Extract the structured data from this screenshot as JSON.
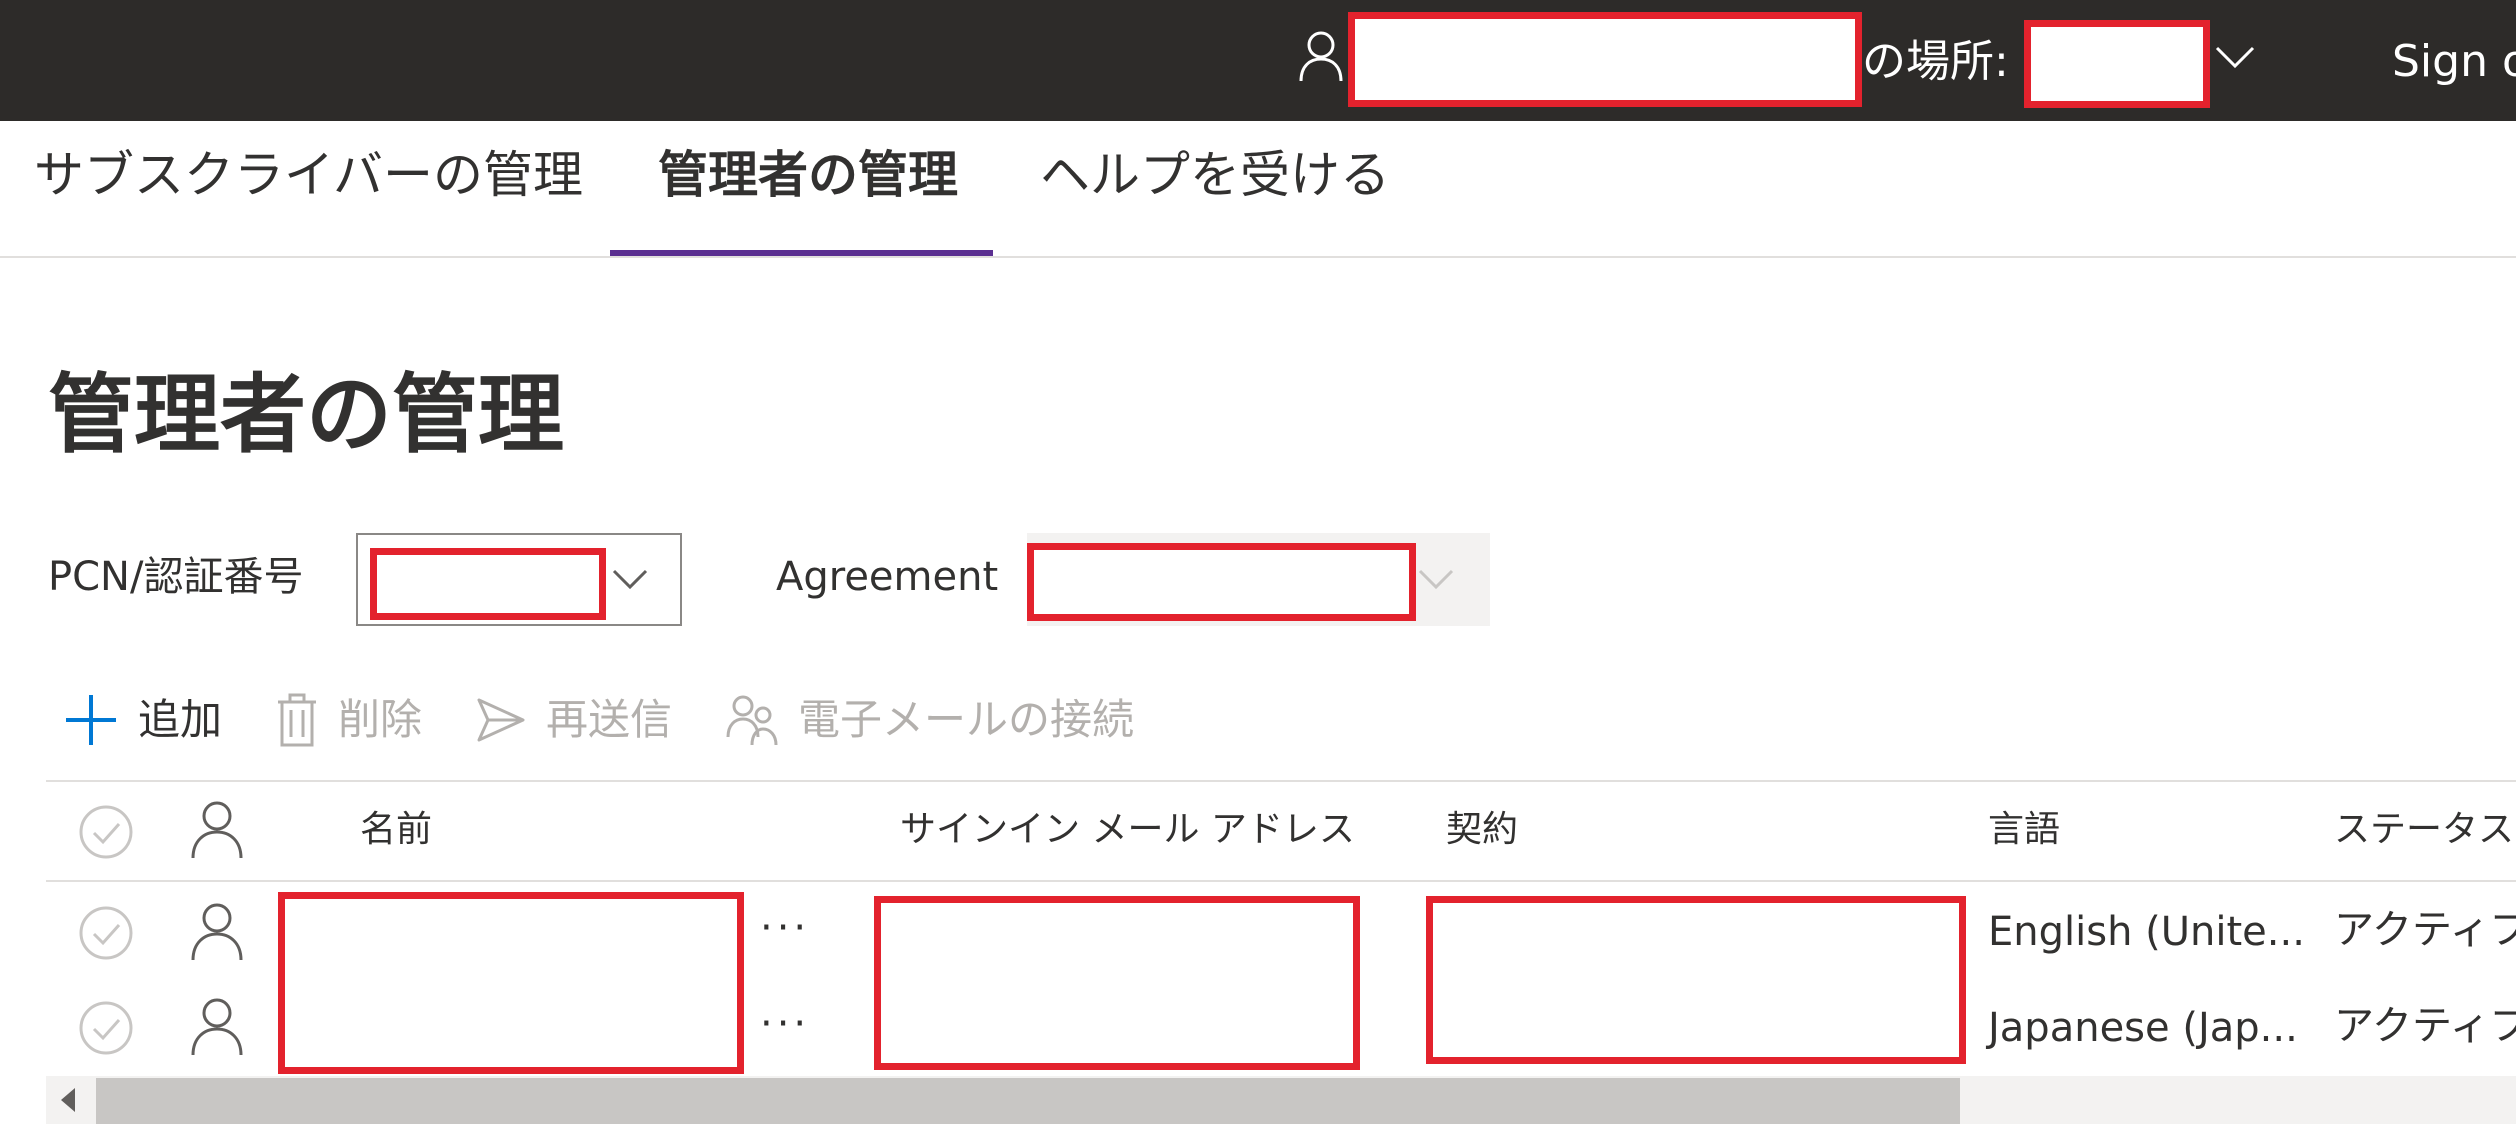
{
  "topbar": {
    "location_label": "の場所:",
    "sign_out_label": "Sign out"
  },
  "nav": {
    "tabs": [
      {
        "label": "サブスクライバーの管理"
      },
      {
        "label": "管理者の管理"
      },
      {
        "label": "ヘルプを受ける"
      }
    ],
    "active_tab": "管理者の管理"
  },
  "page": {
    "title": "管理者の管理"
  },
  "filters": {
    "pcn_label": "PCN/認証番号",
    "agreement_label": "Agreement"
  },
  "commands": {
    "add": "追加",
    "delete": "削除",
    "resend": "再送信",
    "email_connect": "電子メールの接続"
  },
  "table": {
    "headers": {
      "name": "名前",
      "email": "サインイン メール アドレス",
      "agreement": "契約",
      "language": "言語",
      "status": "ステータス"
    },
    "rows": [
      {
        "language": "English (Unite...",
        "status": "アクティブ"
      },
      {
        "language": "Japanese (Jap...",
        "status": "アクティブ"
      }
    ]
  },
  "colors": {
    "topbar_bg": "#2d2b29",
    "accent": "#5b2f91",
    "add_icon": "#0078d4",
    "redaction": "#e3222d"
  }
}
